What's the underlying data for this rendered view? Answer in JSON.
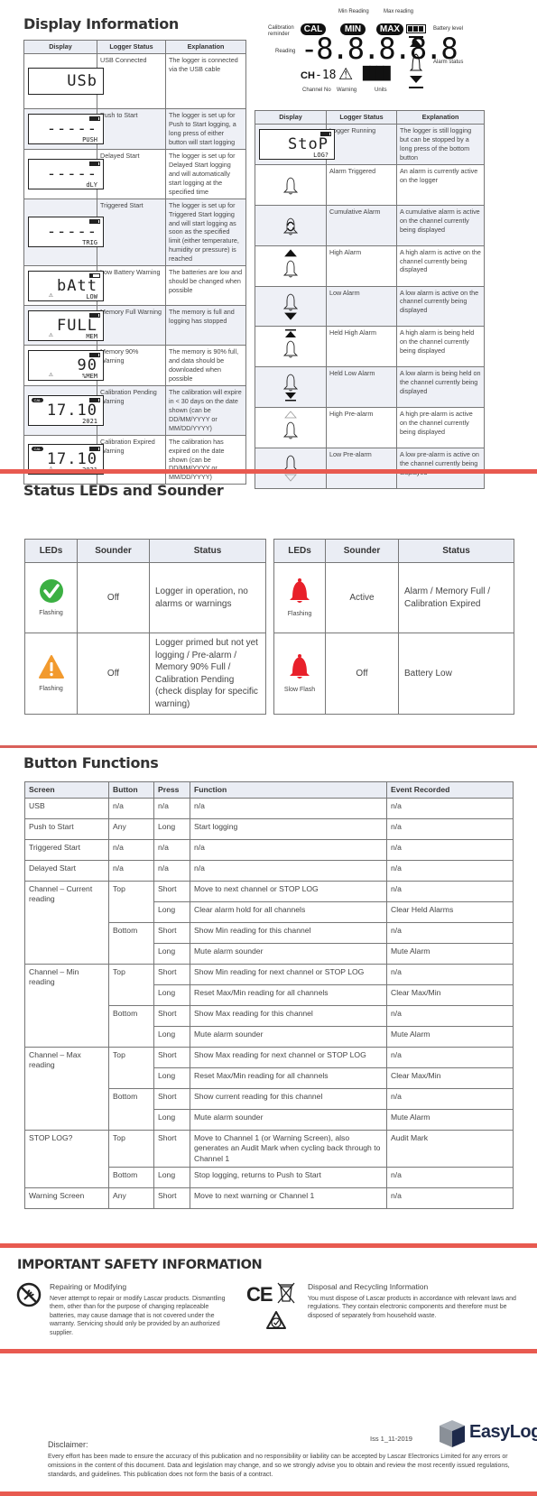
{
  "display_information": {
    "title": "Display Information",
    "left_table": {
      "headers": [
        "Display",
        "Logger Status",
        "Explanation"
      ],
      "rows": [
        {
          "lcd_main": "USb",
          "lcd_sub": "",
          "battery": false,
          "cal": false,
          "warning": false,
          "status": "USB Connected",
          "explanation": "The logger is connected via the USB cable"
        },
        {
          "lcd_main": "-----",
          "lcd_sub": "PUSH",
          "battery": true,
          "cal": false,
          "warning": false,
          "status": "Push to Start",
          "explanation": "The logger is set up for Push to Start logging, a long press of either button will start logging"
        },
        {
          "lcd_main": "-----",
          "lcd_sub": "dLY",
          "battery": true,
          "cal": false,
          "warning": false,
          "status": "Delayed Start",
          "explanation": "The logger is set up for Delayed Start logging and will automatically start logging at the specified time"
        },
        {
          "lcd_main": "-----",
          "lcd_sub": "TRIG",
          "battery": true,
          "cal": false,
          "warning": false,
          "status": "Triggered Start",
          "explanation": "The logger is set up for Triggered Start logging and will start logging as soon as the specified limit (either temperature, humidity or pressure) is reached"
        },
        {
          "lcd_main": "bAtt",
          "lcd_sub": "LOW",
          "battery": "low",
          "cal": false,
          "warning": true,
          "status": "Low Battery Warning",
          "explanation": "The batteries are low and should be changed when possible"
        },
        {
          "lcd_main": "FULL",
          "lcd_sub": "MEM",
          "battery": true,
          "cal": false,
          "warning": true,
          "status": "Memory Full Warning",
          "explanation": "The memory is full and logging has stopped"
        },
        {
          "lcd_main": "90",
          "lcd_sub": "%MEM",
          "battery": true,
          "cal": false,
          "warning": true,
          "status": "Memory 90% Warning",
          "explanation": "The memory is 90% full, and data should be downloaded when possible"
        },
        {
          "lcd_main": "17.10",
          "lcd_sub": "2021",
          "battery": true,
          "cal": true,
          "warning": false,
          "status": "Calibration Pending Warning",
          "explanation": "The calibration will expire in < 30 days on the date shown (can be DD/MM/YYYY or MM/DD/YYYY)"
        },
        {
          "lcd_main": "17.10",
          "lcd_sub": "2021",
          "battery": true,
          "cal": true,
          "warning": true,
          "status": "Calibration Expired Warning",
          "explanation": "The calibration has expired on the date shown (can be DD/MM/YYYY or MM/DD/YYYY)"
        }
      ]
    },
    "diagram": {
      "labels": {
        "calibration_reminder": "Calibration reminder",
        "min_reading": "Min Reading",
        "max_reading": "Max reading",
        "battery_level": "Battery level",
        "reading": "Reading",
        "alarm_status": "Alarm status",
        "channel_no": "Channel No",
        "warning": "Warning",
        "units": "Units"
      },
      "pills": {
        "cal": "CAL",
        "min": "MIN",
        "max": "MAX"
      },
      "reading_digits": "-8.8.8.8.8",
      "channel_prefix": "CH",
      "channel_digits": "-18"
    },
    "right_table": {
      "headers": [
        "Display",
        "Logger Status",
        "Explanation"
      ],
      "rows": [
        {
          "icon": "stop-log-lcd",
          "lcd_main": "StoP",
          "lcd_sub": "LOG?",
          "status": "Logger Running",
          "explanation": "The logger is still logging but can be stopped by a long press of the bottom button"
        },
        {
          "icon": "bell",
          "status": "Alarm Triggered",
          "explanation": "An alarm is currently active on the logger"
        },
        {
          "icon": "bell-cumulative",
          "status": "Cumulative Alarm",
          "explanation": "A cumulative alarm is active on the channel currently being displayed"
        },
        {
          "icon": "bell-high",
          "status": "High Alarm",
          "explanation": "A high alarm is active on the channel currently being displayed"
        },
        {
          "icon": "bell-low",
          "status": "Low Alarm",
          "explanation": "A low alarm is active on the channel currently being displayed"
        },
        {
          "icon": "bell-held-high",
          "status": "Held High Alarm",
          "explanation": "A high alarm is being held on the channel currently being displayed"
        },
        {
          "icon": "bell-held-low",
          "status": "Held Low Alarm",
          "explanation": "A low alarm is being held on the channel currently being displayed"
        },
        {
          "icon": "bell-high-pre",
          "status": "High Pre-alarm",
          "explanation": "A high pre-alarm is active on the channel currently being displayed"
        },
        {
          "icon": "bell-low-pre",
          "status": "Low Pre-alarm",
          "explanation": "A low pre-alarm is active on the channel currently being displayed"
        }
      ]
    }
  },
  "status_leds": {
    "title": "Status LEDs and Sounder",
    "headers": [
      "LEDs",
      "Sounder",
      "Status"
    ],
    "left_rows": [
      {
        "icon": "green-check",
        "caption": "Flashing",
        "sounder": "Off",
        "status": "Logger in operation, no alarms or warnings",
        "color": "#3cb043"
      },
      {
        "icon": "orange-warning",
        "caption": "Flashing",
        "sounder": "Off",
        "status": "Logger primed but not yet logging / Pre-alarm / Memory 90% Full / Calibration Pending (check display for specific warning)",
        "color": "#f29a2e"
      }
    ],
    "right_rows": [
      {
        "icon": "red-bell",
        "caption": "Flashing",
        "sounder": "Active",
        "status": "Alarm / Memory Full / Calibration Expired",
        "color": "#e8202a"
      },
      {
        "icon": "red-bell",
        "caption": "Slow Flash",
        "sounder": "Off",
        "status": "Battery Low",
        "color": "#e8202a"
      }
    ]
  },
  "button_functions": {
    "title": "Button Functions",
    "headers": [
      "Screen",
      "Button",
      "Press",
      "Function",
      "Event Recorded"
    ],
    "groups": [
      {
        "screen": "USB",
        "buttons": [
          {
            "button": "n/a",
            "presses": [
              {
                "press": "n/a",
                "function": "n/a",
                "event": "n/a"
              }
            ]
          }
        ]
      },
      {
        "screen": "Push to Start",
        "buttons": [
          {
            "button": "Any",
            "presses": [
              {
                "press": "Long",
                "function": "Start logging",
                "event": "n/a"
              }
            ]
          }
        ]
      },
      {
        "screen": "Triggered Start",
        "buttons": [
          {
            "button": "n/a",
            "presses": [
              {
                "press": "n/a",
                "function": "n/a",
                "event": "n/a"
              }
            ]
          }
        ]
      },
      {
        "screen": "Delayed Start",
        "buttons": [
          {
            "button": "n/a",
            "presses": [
              {
                "press": "n/a",
                "function": "n/a",
                "event": "n/a"
              }
            ]
          }
        ]
      },
      {
        "screen": "Channel – Current reading",
        "buttons": [
          {
            "button": "Top",
            "presses": [
              {
                "press": "Short",
                "function": "Move to next channel or STOP LOG",
                "event": "n/a"
              },
              {
                "press": "Long",
                "function": "Clear alarm hold for all channels",
                "event": "Clear Held Alarms"
              }
            ]
          },
          {
            "button": "Bottom",
            "presses": [
              {
                "press": "Short",
                "function": "Show Min reading for this channel",
                "event": "n/a"
              },
              {
                "press": "Long",
                "function": "Mute alarm sounder",
                "event": "Mute Alarm"
              }
            ]
          }
        ]
      },
      {
        "screen": "Channel – Min reading",
        "buttons": [
          {
            "button": "Top",
            "presses": [
              {
                "press": "Short",
                "function": "Show Min reading for next channel or STOP LOG",
                "event": "n/a"
              },
              {
                "press": "Long",
                "function": "Reset Max/Min reading for all channels",
                "event": "Clear Max/Min"
              }
            ]
          },
          {
            "button": "Bottom",
            "presses": [
              {
                "press": "Short",
                "function": "Show Max reading for this channel",
                "event": "n/a"
              },
              {
                "press": "Long",
                "function": "Mute alarm sounder",
                "event": "Mute Alarm"
              }
            ]
          }
        ]
      },
      {
        "screen": "Channel – Max reading",
        "buttons": [
          {
            "button": "Top",
            "presses": [
              {
                "press": "Short",
                "function": "Show Max reading for next channel or STOP LOG",
                "event": "n/a"
              },
              {
                "press": "Long",
                "function": "Reset Max/Min reading for all channels",
                "event": "Clear Max/Min"
              }
            ]
          },
          {
            "button": "Bottom",
            "presses": [
              {
                "press": "Short",
                "function": "Show current reading for this channel",
                "event": "n/a"
              },
              {
                "press": "Long",
                "function": "Mute alarm sounder",
                "event": "Mute Alarm"
              }
            ]
          }
        ]
      },
      {
        "screen": "STOP LOG?",
        "buttons": [
          {
            "button": "Top",
            "presses": [
              {
                "press": "Short",
                "function": "Move to Channel 1 (or Warning Screen), also generates an Audit Mark when cycling back through to Channel 1",
                "event": "Audit Mark"
              }
            ]
          },
          {
            "button": "Bottom",
            "presses": [
              {
                "press": "Long",
                "function": "Stop logging, returns to Push to Start",
                "event": "n/a"
              }
            ]
          }
        ]
      },
      {
        "screen": "Warning Screen",
        "buttons": [
          {
            "button": "Any",
            "presses": [
              {
                "press": "Short",
                "function": "Move to next warning or Channel 1",
                "event": "n/a"
              }
            ]
          }
        ]
      }
    ]
  },
  "safety": {
    "title": "IMPORTANT SAFETY INFORMATION",
    "repair": {
      "heading": "Repairing or Modifying",
      "body": "Never attempt to repair or modify Lascar products. Dismantling them, other than for the purpose of changing replaceable batteries, may cause damage that is not covered under the warranty. Servicing should only be provided by an authorized supplier."
    },
    "disposal": {
      "heading": "Disposal and Recycling Information",
      "body": "You must dispose of Lascar products in accordance with relevant laws and regulations. They contain electronic components and therefore must be disposed of separately from household waste."
    },
    "ce_mark": "CE"
  },
  "footer": {
    "issue": "Iss 1_11-2019",
    "brand": "EasyLog",
    "disclaimer_heading": "Disclaimer:",
    "disclaimer_body": "Every effort has been made to ensure the accuracy of this publication and no responsibility or liability can be accepted by Lascar Electronics Limited for any errors or omissions in the content of this document. Data and legislation may change, and so we strongly advise you to obtain and review the most recently issued regulations, standards, and guidelines. This publication does not form the basis of a contract."
  },
  "colors": {
    "accent_red": "#e85a50",
    "header_fill": "#eaedf4",
    "row_shade": "#eef0f6"
  }
}
